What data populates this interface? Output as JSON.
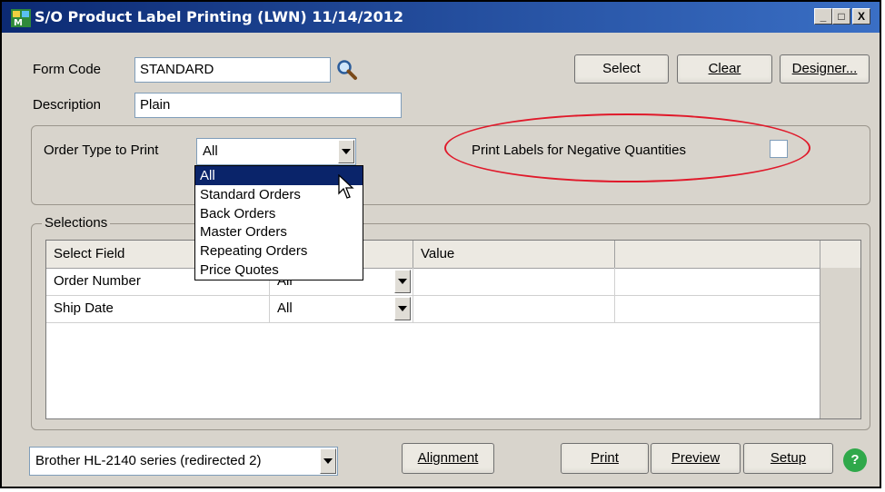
{
  "window": {
    "title": "S/O Product Label Printing (LWN) 11/14/2012",
    "controls": {
      "minimize": "_",
      "maximize": "□",
      "close": "X"
    }
  },
  "form": {
    "form_code_label": "Form Code",
    "form_code_value": "STANDARD",
    "description_label": "Description",
    "description_value": "Plain"
  },
  "toolbar": {
    "select_label": "Select",
    "clear_label": "Clear",
    "designer_label": "Designer..."
  },
  "options": {
    "order_type_label": "Order Type to Print",
    "order_type_value": "All",
    "order_type_options": [
      "All",
      "Standard Orders",
      "Back Orders",
      "Master Orders",
      "Repeating Orders",
      "Price Quotes"
    ],
    "negative_qty_label": "Print Labels for Negative Quantities",
    "negative_qty_checked": false
  },
  "selections": {
    "group_label": "Selections",
    "columns": [
      "Select Field",
      "",
      "Value",
      ""
    ],
    "rows": [
      {
        "field": "Order Number",
        "operator": "All",
        "value": ""
      },
      {
        "field": "Ship Date",
        "operator": "All",
        "value": ""
      }
    ]
  },
  "footer": {
    "printer_value": "Brother HL-2140 series (redirected 2)",
    "alignment_label": "Alignment",
    "print_label": "Print",
    "preview_label": "Preview",
    "setup_label": "Setup",
    "help_icon": "?"
  },
  "colors": {
    "titlebar": "#0c2a73",
    "highlight": "#0a246a",
    "annotation_ellipse": "#e0192a",
    "help": "#2fa84a"
  }
}
